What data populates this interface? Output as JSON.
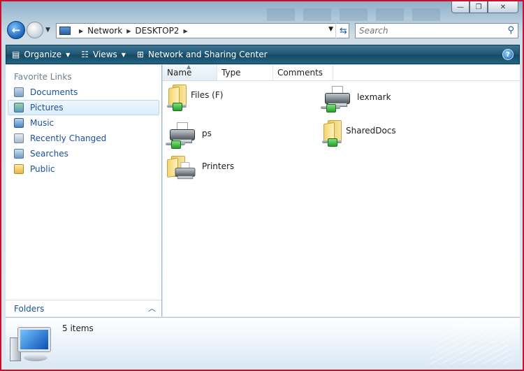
{
  "window": {
    "min_glyph": "—",
    "max_glyph": "❐",
    "close_glyph": "✕"
  },
  "address": {
    "path": [
      "Network",
      "DESKTOP2"
    ]
  },
  "search": {
    "placeholder": "Search"
  },
  "toolbar": {
    "organize": "Organize",
    "views": "Views",
    "network_center": "Network and Sharing Center",
    "help": "?"
  },
  "left": {
    "favorite_links_title": "Favorite Links",
    "links": [
      {
        "label": "Documents",
        "icon": "documents-icon"
      },
      {
        "label": "Pictures",
        "icon": "pictures-icon"
      },
      {
        "label": "Music",
        "icon": "music-icon"
      },
      {
        "label": "Recently Changed",
        "icon": "recently-changed-icon"
      },
      {
        "label": "Searches",
        "icon": "searches-icon"
      },
      {
        "label": "Public",
        "icon": "public-icon"
      }
    ],
    "selected_index": 1,
    "folders_label": "Folders"
  },
  "columns": {
    "name": "Name",
    "type": "Type",
    "comments": "Comments"
  },
  "items": [
    {
      "label": "Files (F)",
      "kind": "shared-folder"
    },
    {
      "label": "lexmark",
      "kind": "shared-printer"
    },
    {
      "label": "ps",
      "kind": "shared-printer"
    },
    {
      "label": "SharedDocs",
      "kind": "shared-folder"
    },
    {
      "label": "Printers",
      "kind": "printers-folder"
    }
  ],
  "details": {
    "count_text": "5 items"
  },
  "colors": {
    "link_blue": "#1a4f9c",
    "toolbar_dark": "#1e5672",
    "frame_red": "#c8102e"
  }
}
